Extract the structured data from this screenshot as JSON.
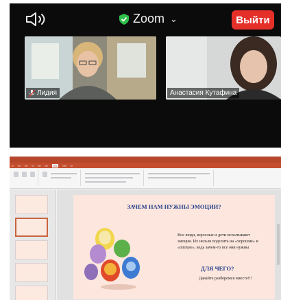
{
  "zoom": {
    "title": "Zoom",
    "leave_label": "Выйти",
    "accent_color": "#e5302a",
    "participants": [
      {
        "name": "Лидия"
      },
      {
        "name": "Анастасия Кутафина"
      }
    ]
  },
  "powerpoint": {
    "brand_color": "#b7472a",
    "slide": {
      "title": "ЗАЧЕМ НАМ НУЖНЫ ЭМОЦИИ?",
      "body": "Все люди, взрослые и дети испытывают эмоции. Их нельзя поделить на «хорошие» и «плохие», ведь зачем-то все они нужны",
      "subtitle": "ДЛЯ ЧЕГО?",
      "subtext": "Давайте разберемся вместе!!!"
    }
  }
}
